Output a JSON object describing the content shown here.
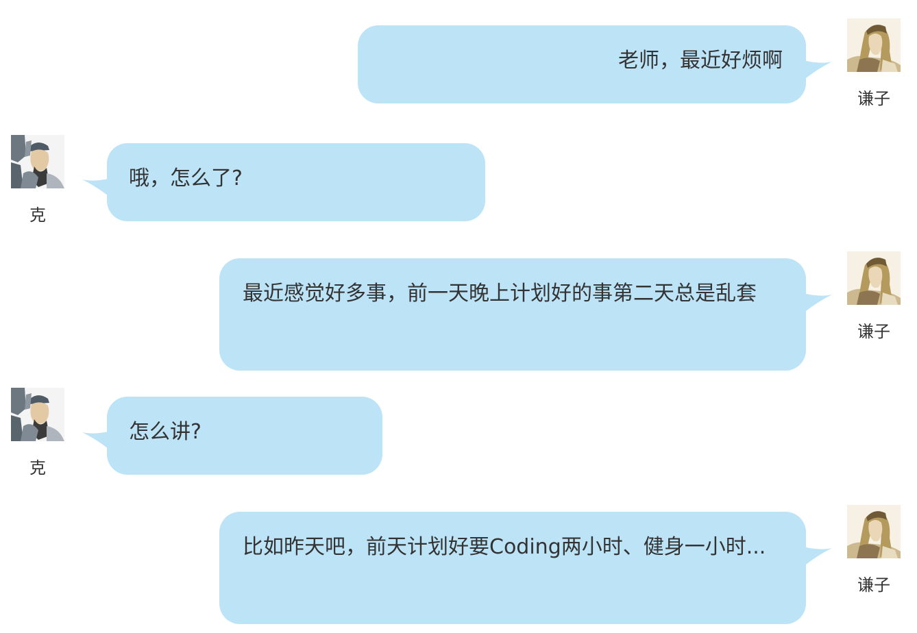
{
  "bubble_color": "#bde3f7",
  "messages": [
    {
      "side": "right",
      "speaker": "谦子",
      "text": "老师，最近好烦啊"
    },
    {
      "side": "left",
      "speaker": "克",
      "text": "哦，怎么了?"
    },
    {
      "side": "right",
      "speaker": "谦子",
      "text": "最近感觉好多事，前一天晚上计划好的事第二天总是乱套"
    },
    {
      "side": "left",
      "speaker": "克",
      "text": "怎么讲?"
    },
    {
      "side": "right",
      "speaker": "谦子",
      "text": "比如昨天吧，前天计划好要Coding两小时、健身一小时..."
    }
  ]
}
